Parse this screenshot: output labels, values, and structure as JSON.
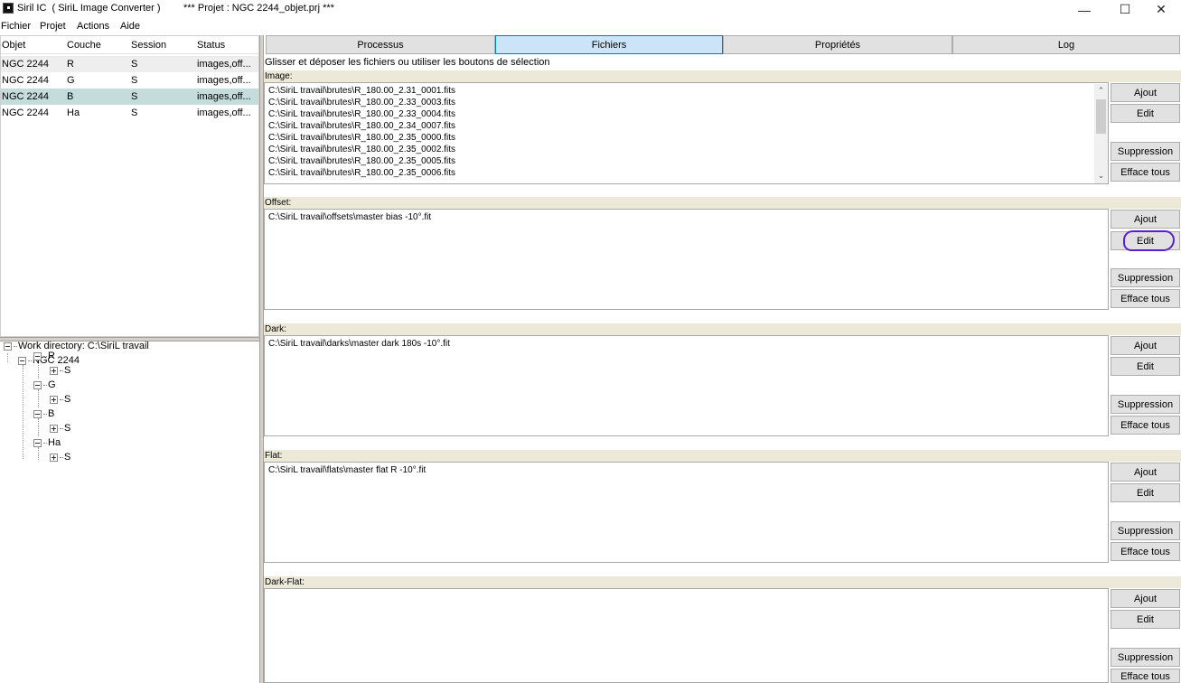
{
  "window": {
    "app_title": "Siril IC  ( SiriL Image Converter )",
    "project_title": "*** Projet : NGC 2244_objet.prj ***",
    "minimize": "—",
    "maximize": "☐",
    "close": "✕"
  },
  "menu": [
    "Fichier",
    "Projet",
    "Actions",
    "Aide"
  ],
  "object_list": {
    "headers": [
      "Objet",
      "Couche",
      "Session",
      "Status"
    ],
    "rows": [
      [
        "NGC 2244",
        "R",
        "S",
        "images,off..."
      ],
      [
        "NGC 2244",
        "G",
        "S",
        "images,off..."
      ],
      [
        "NGC 2244",
        "B",
        "S",
        "images,off..."
      ],
      [
        "NGC 2244",
        "Ha",
        "S",
        "images,off..."
      ]
    ],
    "selected_row": 2
  },
  "tree": {
    "root": "Work directory: C:\\SiriL travail",
    "object": "NGC 2244",
    "layers": [
      "R",
      "G",
      "B",
      "Ha"
    ],
    "session": "S"
  },
  "tabs": [
    "Processus",
    "Fichiers",
    "Propriétés",
    "Log"
  ],
  "active_tab": "Fichiers",
  "instruction": "Glisser et déposer les fichiers ou utiliser les boutons de sélection",
  "buttons": {
    "add": "Ajout",
    "edit": "Edit",
    "remove": "Suppression",
    "clear": "Efface tous"
  },
  "sections": {
    "image": {
      "label": "Image:",
      "files": [
        "C:\\SiriL travail\\brutes\\R_180.00_2.31_0001.fits",
        "C:\\SiriL travail\\brutes\\R_180.00_2.33_0003.fits",
        "C:\\SiriL travail\\brutes\\R_180.00_2.33_0004.fits",
        "C:\\SiriL travail\\brutes\\R_180.00_2.34_0007.fits",
        "C:\\SiriL travail\\brutes\\R_180.00_2.35_0000.fits",
        "C:\\SiriL travail\\brutes\\R_180.00_2.35_0002.fits",
        "C:\\SiriL travail\\brutes\\R_180.00_2.35_0005.fits",
        "C:\\SiriL travail\\brutes\\R_180.00_2.35_0006.fits"
      ]
    },
    "offset": {
      "label": "Offset:",
      "files": [
        "C:\\SiriL travail\\offsets\\master bias -10°.fit"
      ]
    },
    "dark": {
      "label": "Dark:",
      "files": [
        "C:\\SiriL travail\\darks\\master dark 180s -10°.fit"
      ]
    },
    "flat": {
      "label": "Flat:",
      "files": [
        "C:\\SiriL travail\\flats\\master flat R -10°.fit"
      ]
    },
    "darkflat": {
      "label": "Dark-Flat:",
      "files": []
    }
  },
  "colors": {
    "active_tab_bg": "#cce4f7",
    "selected_row_bg": "#c4dcdc",
    "section_header_bg": "#ece9d8",
    "annotation_circle": "#5a1fd1"
  }
}
